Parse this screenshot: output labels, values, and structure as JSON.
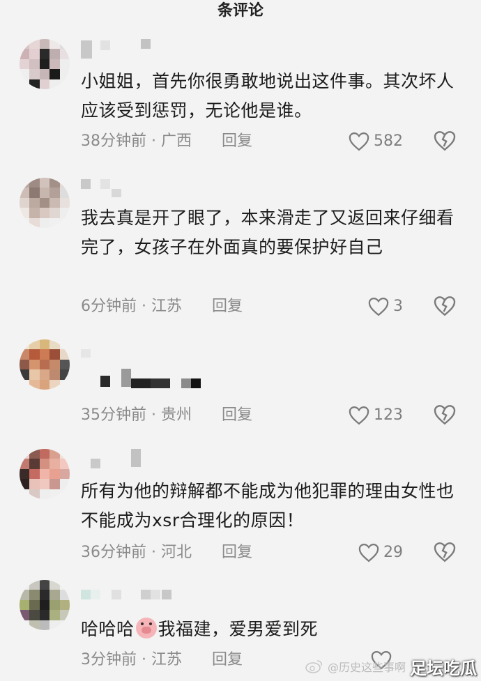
{
  "header": {
    "title": "条评论"
  },
  "comments": [
    {
      "text": "小姐姐，首先你很勇敢地说出这件事。其次坏人应该受到惩罚，无论他是谁。",
      "time_location": "38分钟前 · 广西",
      "reply_label": "回复",
      "likes": "582"
    },
    {
      "text": "我去真是开了眼了，本来滑走了又返回来仔细看完了，女孩子在外面真的要保护好自己",
      "time_location": "6分钟前 · 江苏",
      "reply_label": "回复",
      "likes": "3"
    },
    {
      "text": "",
      "time_location": "35分钟前 · 贵州",
      "reply_label": "回复",
      "likes": "123"
    },
    {
      "text": "所有为他的辩解都不能成为他犯罪的理由女性也不能成为xsr合理化的原因！",
      "time_location": "36分钟前 · 河北",
      "reply_label": "回复",
      "likes": "29"
    },
    {
      "text_before": "哈哈哈",
      "emoji": "pig-emoji",
      "text_after": "我福建，爱男爱到死",
      "time_location": "3分钟前 · 江苏",
      "reply_label": "回复",
      "likes": ""
    }
  ],
  "watermark": {
    "account": "@历史这些事啊",
    "brand": "足坛吃瓜"
  },
  "icons": {
    "like": "heart-outline-icon",
    "dislike": "broken-heart-icon",
    "weibo": "weibo-logo-icon"
  }
}
